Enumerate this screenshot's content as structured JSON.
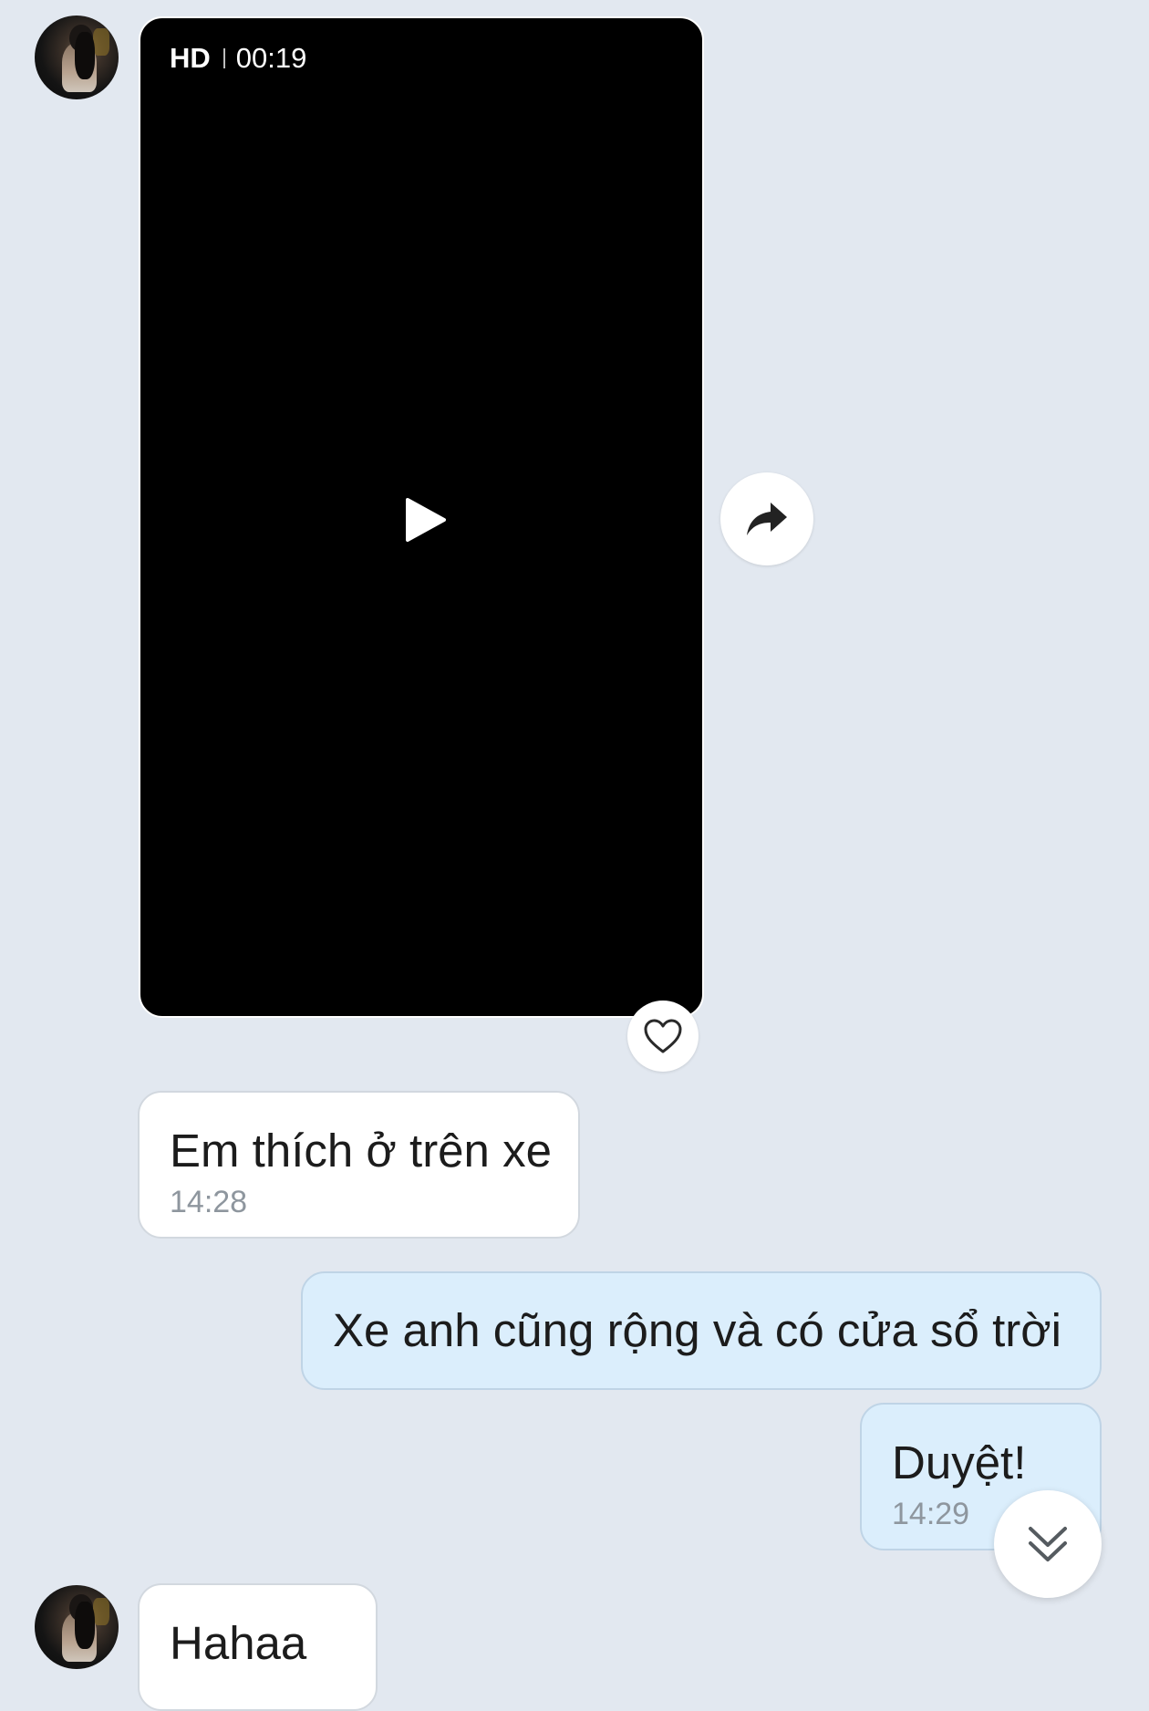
{
  "video_message": {
    "quality": "HD",
    "duration": "00:19"
  },
  "icons": {
    "play": "play-icon",
    "share": "share-arrow-icon",
    "like": "heart-outline-icon",
    "scroll": "double-chevron-down-icon"
  },
  "messages": [
    {
      "direction": "incoming",
      "text": "Em thích ở trên xe",
      "time": "14:28"
    },
    {
      "direction": "outgoing",
      "text": "Xe anh cũng rộng và có cửa sổ trời"
    },
    {
      "direction": "outgoing",
      "text": "Duyệt!",
      "time": "14:29"
    },
    {
      "direction": "incoming",
      "text": "Hahaa"
    }
  ],
  "colors": {
    "background": "#e2e8f0",
    "incoming_bubble": "#ffffff",
    "outgoing_bubble": "#dbeefc",
    "timestamp": "#8e969e"
  }
}
